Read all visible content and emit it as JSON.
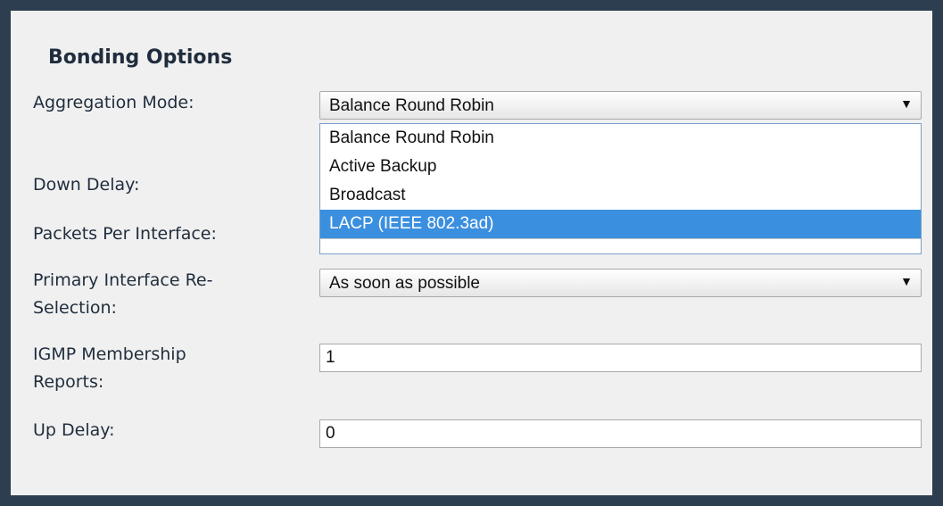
{
  "bonding": {
    "title": "Bonding Options",
    "aggregation_mode": {
      "label": "Aggregation Mode:",
      "value": "Balance Round Robin",
      "options": [
        "Balance Round Robin",
        "Active Backup",
        "Broadcast",
        "LACP (IEEE 802.3ad)"
      ],
      "highlighted": "LACP (IEEE 802.3ad)"
    },
    "down_delay": {
      "label": "Down Delay:"
    },
    "packets_per_interface": {
      "label": "Packets Per Interface:"
    },
    "primary_reselection": {
      "label_line1": "Primary Interface Re-",
      "label_line2": "Selection:",
      "value": "As soon as possible"
    },
    "igmp_reports": {
      "label_line1": "IGMP Membership",
      "label_line2": "Reports:",
      "value": "1"
    },
    "up_delay": {
      "label": "Up Delay:",
      "value": "0"
    }
  },
  "icons": {
    "dropdown_arrow": "▼"
  }
}
